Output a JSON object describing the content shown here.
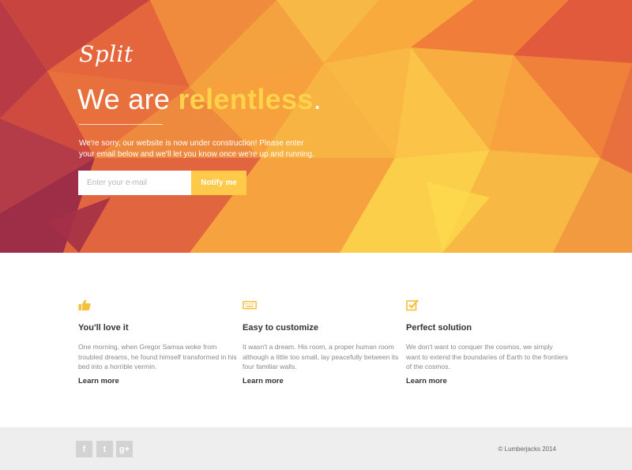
{
  "hero": {
    "logo": "Split",
    "headline_prefix": "We are ",
    "headline_accent": "relentless",
    "headline_suffix": ".",
    "intro": "We're sorry, our website is now under construction! Please enter your email below and we'll let you know once we're up and running.",
    "email_placeholder": "Enter your e-mail",
    "notify_label": "Notify me",
    "accent_color": "#ffd24a"
  },
  "features": [
    {
      "icon": "thumbs-up-icon",
      "title": "You'll love it",
      "text": "One morning, when Gregor Samsa woke from troubled dreams, he found himself transformed in his bed into a horrible vermin.",
      "link": "Learn more"
    },
    {
      "icon": "keyboard-icon",
      "title": "Easy to customize",
      "text": "It wasn't a dream. His room, a proper human room although a little too small, lay peacefully between its four familiar walls.",
      "link": "Learn more"
    },
    {
      "icon": "checkbox-icon",
      "title": "Perfect solution",
      "text": "We don't want to conquer the cosmos, we simply want to extend the boundaries of Earth to the frontiers of the cosmos.",
      "link": "Learn more"
    }
  ],
  "footer": {
    "social": [
      {
        "icon": "facebook-icon",
        "glyph": "f"
      },
      {
        "icon": "twitter-icon",
        "glyph": "t"
      },
      {
        "icon": "google-plus-icon",
        "glyph": "g+"
      }
    ],
    "copyright": "© Lumberjacks 2014"
  },
  "colors": {
    "icon_yellow": "#f7c03a",
    "footer_bg": "#eeeeee"
  }
}
